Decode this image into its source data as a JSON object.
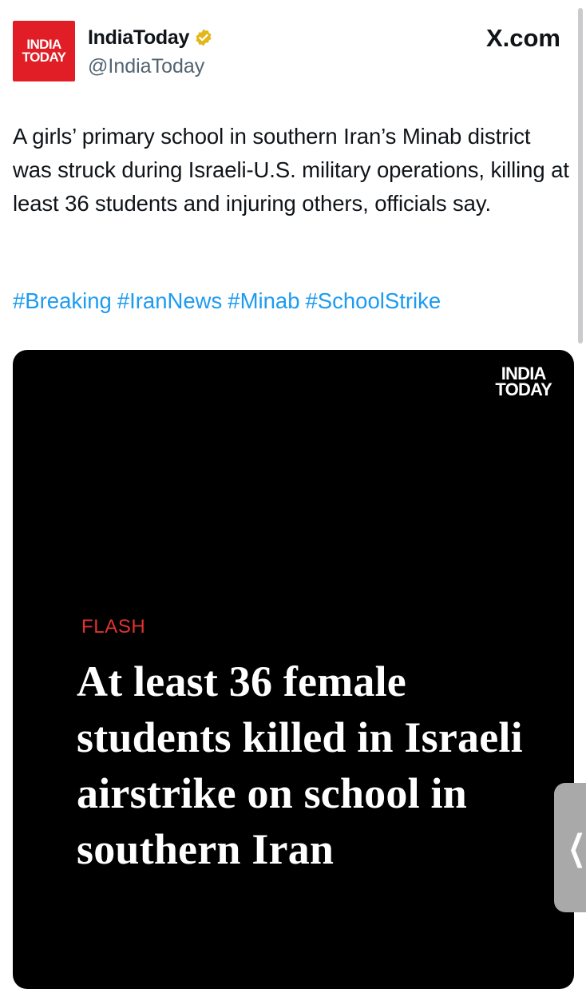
{
  "account": {
    "avatar_text_line1": "INDIA",
    "avatar_text_line2": "TODAY",
    "display_name": "IndiaToday",
    "verified_icon": "gold-verified-badge-icon",
    "handle": "@IndiaToday"
  },
  "source_label": "X.com",
  "tweet": {
    "text": "A girls’ primary school in southern Iran’s Minab district was struck during Israeli-U.S. military operations, killing at least 36 students and injuring others, officials say.",
    "hashtags": [
      "#Breaking",
      "#IranNews",
      "#Minab",
      "#SchoolStrike"
    ]
  },
  "media": {
    "logo_line1": "INDIA",
    "logo_line2": "TODAY",
    "flash_label": "FLASH",
    "headline": "At least 36 female students killed in Israeli airstrike on school in southern Iran"
  },
  "colors": {
    "brand_red": "#e11e26",
    "link_blue": "#1d9bf0",
    "flash_red": "#e0322f",
    "verified_gold": "#e2b719"
  },
  "side_handle_icon": "chevron-left-icon",
  "side_handle_glyph": "❮"
}
